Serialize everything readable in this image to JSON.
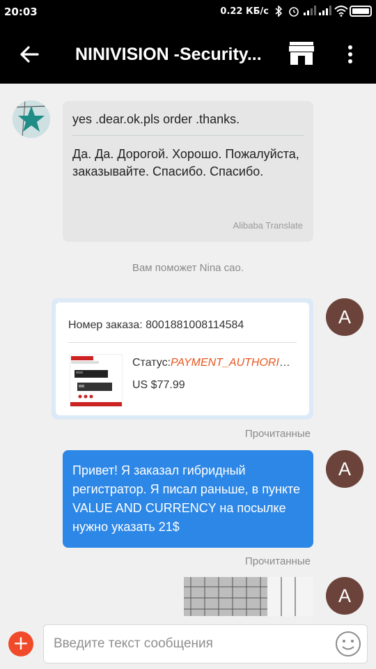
{
  "status_bar": {
    "time": "20:03",
    "speed": "0.22 КБ/с"
  },
  "header": {
    "title": "NINIVISION -Security...",
    "icons": [
      "back-arrow-icon",
      "store-icon",
      "more-vert-icon"
    ]
  },
  "messages": {
    "incoming": {
      "original": "yes .dear.ok.pls order .thanks.",
      "translated": "Да. Да. Дорогой. Хорошо. Пожалуйста, заказывайте. Спасибо. Спасибо.",
      "translator": "Alibaba Translate"
    },
    "system": "Вам поможет Nina cao.",
    "order": {
      "number_label": "Номер заказа: 8001881008114584",
      "status_label": "Статус:",
      "status_value": "PAYMENT_AUTHORIZED",
      "price": "US $77.99"
    },
    "read_label_1": "Прочитанные",
    "outgoing": {
      "text": "Привет! Я заказал гибридный регистратор. Я писал раньше, в пункте VALUE AND CURRENCY на посылке нужно указать 21$"
    },
    "read_label_2": "Прочитанные",
    "avatar_letter": "A"
  },
  "input": {
    "placeholder": "Введите текст сообщения"
  },
  "colors": {
    "outgoing_bubble": "#2d87e6",
    "incoming_bubble": "#e6e6e6",
    "status_accent": "#e8561f",
    "avatar": "#6b433a",
    "plus_button": "#f04a2a"
  }
}
